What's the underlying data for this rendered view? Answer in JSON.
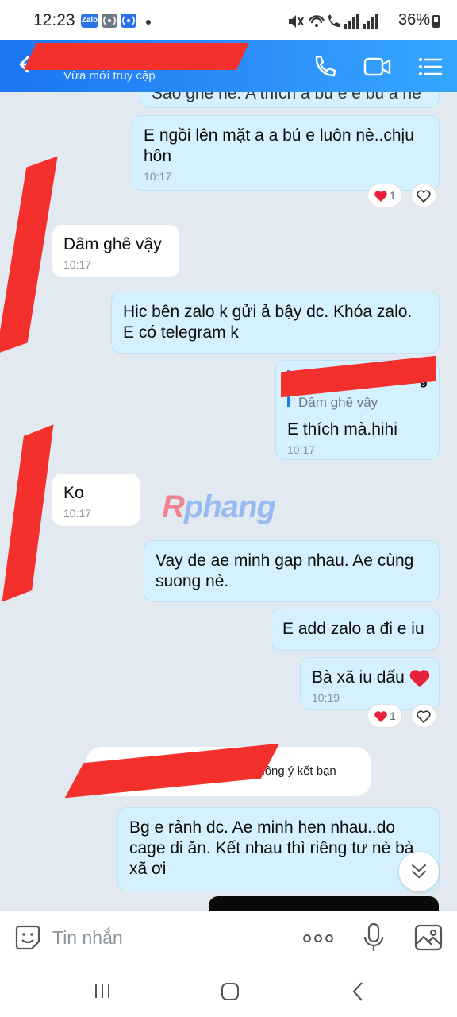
{
  "status_bar": {
    "time": "12:23",
    "app_badge": "Zalo",
    "battery": "36%"
  },
  "header": {
    "subtitle": "Vừa mới truy cập",
    "icons": [
      "back-arrow-icon",
      "phone-icon",
      "video-call-icon",
      "menu-list-icon"
    ]
  },
  "messages": {
    "m0_partial": "Sao ghê nè. A thích ả bú e e bú a hè",
    "m1": {
      "text": "E ngồi lên mặt a a bú e luôn nè..chịu hôn",
      "time": "10:17",
      "reaction_count": "1"
    },
    "m2": {
      "text": "Dâm ghê vậy",
      "time": "10:17"
    },
    "m3": {
      "text": "Hic bên zalo k gửi ả bậy dc. Khóa zalo. E có telegram k"
    },
    "m4": {
      "quote_author_tail": "g",
      "quote_text": "Dâm ghê vậy",
      "text": "E thích mà.hihi",
      "time": "10:17"
    },
    "m5": {
      "text": "Ko",
      "time": "10:17"
    },
    "m6": {
      "text": "Vay de ae minh gap nhau. Ae cùng suong nè."
    },
    "m7": {
      "text": "E add zalo a đi e iu"
    },
    "m8": {
      "text": "Bà xã iu dấu",
      "time": "10:19",
      "reaction_count": "1"
    },
    "system": "g đã đồng ý kết bạn",
    "m9": {
      "text": "Bg e rảnh dc. Ae minh hen nhau..do cage di ăn. Kết nhau thì riêng tư nè bà xã ơi"
    }
  },
  "watermark": {
    "first": "R",
    "rest": "phang"
  },
  "input": {
    "placeholder": "Tin nhắn"
  },
  "colors": {
    "header_start": "#1b77f2",
    "header_end": "#36a6ff",
    "bubble_out": "#d5f1ff",
    "bubble_in": "#ffffff",
    "chat_bg": "#e2e9f1",
    "redaction": "#f3302c",
    "heart": "#e8203a"
  }
}
